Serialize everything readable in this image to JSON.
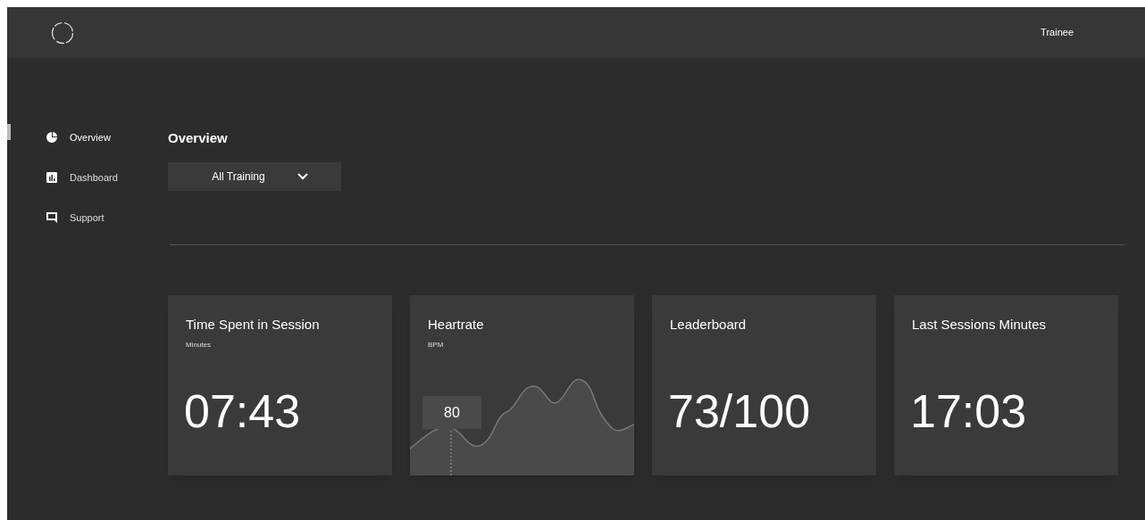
{
  "header": {
    "user": "Trainee"
  },
  "sidebar": {
    "items": [
      {
        "label": "Overview",
        "selected": true
      },
      {
        "label": "Dashboard",
        "selected": false
      },
      {
        "label": "Support",
        "selected": false
      }
    ]
  },
  "page_title": "Overview",
  "filter": {
    "value": "All Training"
  },
  "cards": [
    {
      "kind": "metric",
      "title": "Time Spent in Session",
      "subtitle": "Minutes",
      "value": "07:43"
    },
    {
      "kind": "sparkline",
      "title": "Heartrate",
      "subtitle": "BPM",
      "tooltip": "80"
    },
    {
      "kind": "metric",
      "title": "Leaderboard",
      "value": "73/100"
    },
    {
      "kind": "metric",
      "title": "Last Sessions Minutes",
      "value": "17:03"
    }
  ]
}
